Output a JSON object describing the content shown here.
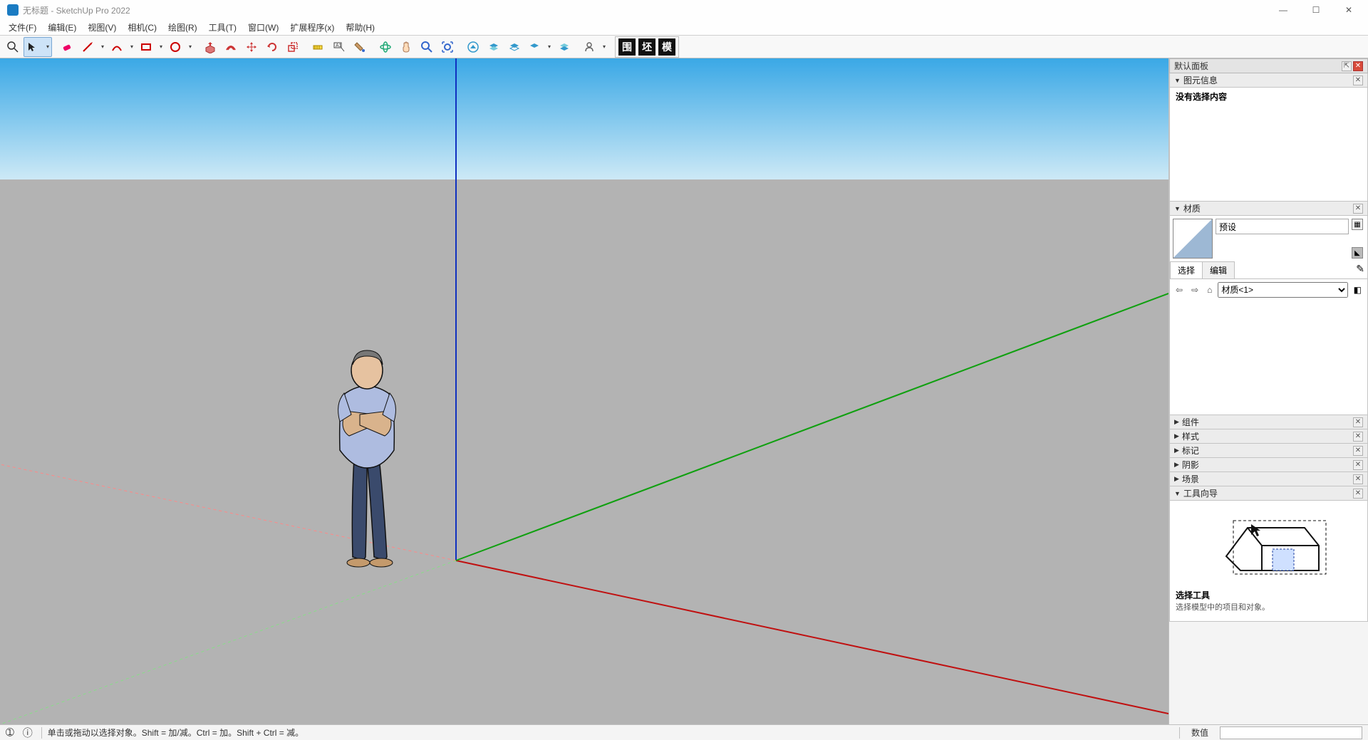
{
  "title": "无标题 - SketchUp Pro 2022",
  "menus": [
    "文件(F)",
    "编辑(E)",
    "视图(V)",
    "相机(C)",
    "绘图(R)",
    "工具(T)",
    "窗口(W)",
    "扩展程序(x)",
    "帮助(H)"
  ],
  "tray": {
    "title": "默认面板",
    "entity_info_title": "图元信息",
    "entity_info_empty": "没有选择内容",
    "materials_title": "材质",
    "materials_default_name": "预设",
    "materials_tab_select": "选择",
    "materials_tab_edit": "编辑",
    "materials_library": "材质<1>",
    "collapsed_panels": [
      "组件",
      "样式",
      "标记",
      "阴影",
      "场景"
    ],
    "instructor_title": "工具向导",
    "instructor_tool": "选择工具",
    "instructor_desc": "选择模型中的项目和对象。"
  },
  "status": {
    "hint": "单击或拖动以选择对象。Shift = 加/减。Ctrl = 加。Shift + Ctrl = 减。",
    "measure_label": "数值"
  },
  "eh_squares": [
    "围",
    "坯",
    "模"
  ]
}
